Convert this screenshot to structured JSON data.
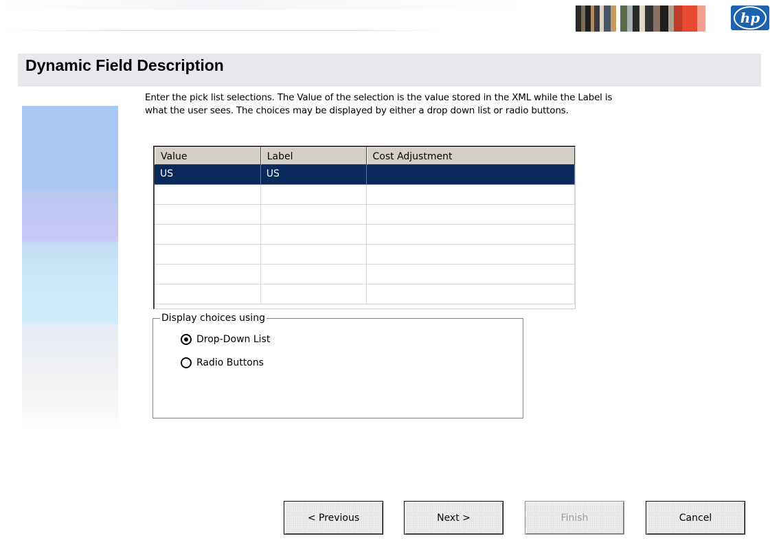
{
  "header": {
    "title": "Dynamic Field Description",
    "logo_text": "hp"
  },
  "instructions": {
    "line1": "Enter the pick list selections.  The Value of the selection is the value stored in the XML while the Label is",
    "line2": "what the user sees.  The choices may be displayed by either a drop down list or radio buttons."
  },
  "grid": {
    "columns": [
      "Value",
      "Label",
      "Cost Adjustment"
    ],
    "rows": [
      [
        "US",
        "US",
        ""
      ],
      [
        "",
        "",
        ""
      ],
      [
        "",
        "",
        ""
      ],
      [
        "",
        "",
        ""
      ],
      [
        "",
        "",
        ""
      ],
      [
        "",
        "",
        ""
      ],
      [
        "",
        "",
        ""
      ]
    ],
    "selected_row": 0
  },
  "display_choices": {
    "legend": "Display choices using",
    "options": [
      {
        "label": "Drop-Down List",
        "checked": true
      },
      {
        "label": "Radio Buttons",
        "checked": false
      }
    ]
  },
  "buttons": {
    "previous": "< Previous",
    "next": "Next >",
    "finish": "Finish",
    "cancel": "Cancel"
  },
  "colors": {
    "selection_bg": "#0a2a5c",
    "title_bar_bg": "#e8e8ec",
    "hp_blue": "#1d62b0"
  }
}
